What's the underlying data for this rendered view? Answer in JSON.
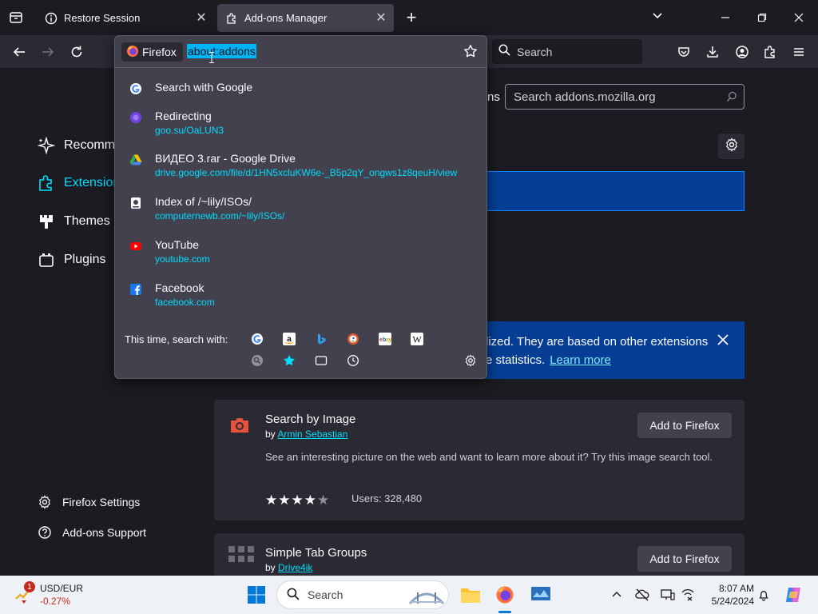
{
  "tabs": [
    {
      "title": "Restore Session",
      "icon": "info-icon",
      "active": false
    },
    {
      "title": "Add-ons Manager",
      "icon": "puzzle-icon",
      "active": true
    }
  ],
  "navbar": {
    "search_placeholder": "Search"
  },
  "urlbar": {
    "identity_label": "Firefox",
    "value": "about:addons"
  },
  "results": [
    {
      "icon": "google-icon",
      "title": "Search with Google",
      "url": ""
    },
    {
      "icon": "redirect-icon",
      "title": "Redirecting",
      "url": "goo.su/OaLUN3"
    },
    {
      "icon": "google-drive-icon",
      "title": "ВИДЕО 3.rar - Google Drive",
      "url": "drive.google.com/file/d/1HN5xcluKW6e-_B5p2qY_ongws1z8qeuH/view"
    },
    {
      "icon": "index-icon",
      "title": "Index of /~lily/ISOs/",
      "url": "computernewb.com/~lily/ISOs/"
    },
    {
      "icon": "youtube-icon",
      "title": "YouTube",
      "url": "youtube.com"
    },
    {
      "icon": "facebook-icon",
      "title": "Facebook",
      "url": "facebook.com"
    }
  ],
  "search_with": {
    "label": "This time, search with:",
    "engines": [
      "google",
      "amazon",
      "bing",
      "duckduckgo",
      "ebay",
      "wikipedia"
    ],
    "modes": [
      "search-engine",
      "bookmarks",
      "tabs",
      "history"
    ]
  },
  "sidebar": {
    "categories": [
      {
        "label": "Recommendations",
        "icon": "sparkle-icon"
      },
      {
        "label": "Extensions",
        "icon": "puzzle-icon",
        "selected": true
      },
      {
        "label": "Themes",
        "icon": "brush-icon"
      },
      {
        "label": "Plugins",
        "icon": "plugin-icon"
      }
    ],
    "footer": [
      {
        "label": "Firefox Settings",
        "icon": "gear-icon"
      },
      {
        "label": "Add-ons Support",
        "icon": "help-icon"
      }
    ]
  },
  "main": {
    "amo_prefix": "ns",
    "amo_search_placeholder": "Search addons.mozilla.org",
    "notice_line1": "lized. They are based on other extensions",
    "notice_line2": "e statistics.",
    "notice_link": "Learn more"
  },
  "cards": [
    {
      "title": "Search by Image",
      "by": "by",
      "author": "Armin Sebastian",
      "description": "See an interesting picture on the web and want to learn more about it? Try this image search tool.",
      "rating": 4.5,
      "users": "Users: 328,480",
      "button": "Add to Firefox"
    },
    {
      "title": "Simple Tab Groups",
      "by": "by",
      "author": "Drive4ik",
      "button": "Add to Firefox"
    }
  ],
  "taskbar": {
    "widget_title": "USD/EUR",
    "widget_value": "-0.27%",
    "widget_badge": "1",
    "search_label": "Search",
    "time": "8:07 AM",
    "date": "5/24/2024"
  },
  "colors": {
    "accent": "#00ddff",
    "selection": "#00b3f4",
    "notice_bg": "#053e94"
  }
}
